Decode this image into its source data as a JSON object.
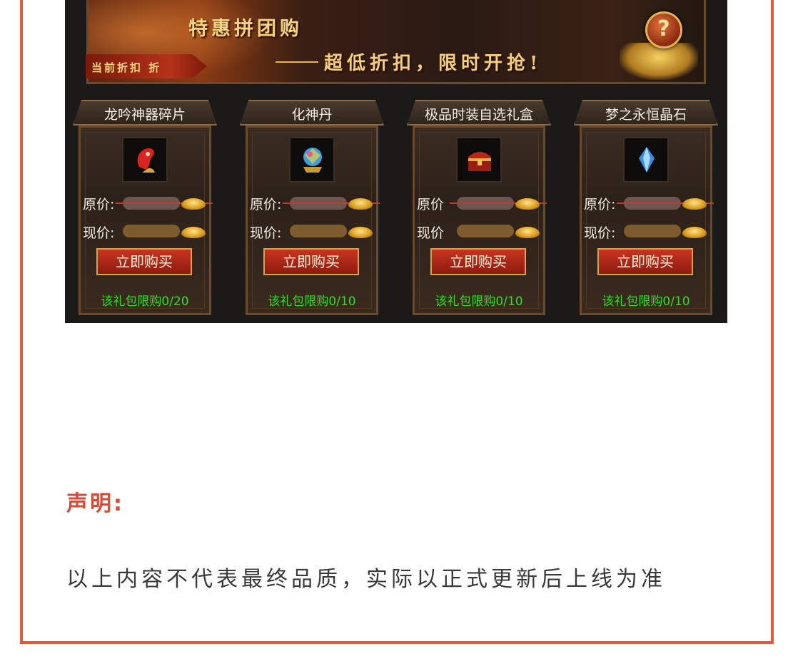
{
  "banner": {
    "title": "特惠拼团购",
    "subtitle": "超低折扣，限时开抢!",
    "discount_label": "当前折扣    折",
    "help_label": "?"
  },
  "cards": [
    {
      "name": "龙吟神器碎片",
      "orig_label": "原价:",
      "now_label": "现价:",
      "buy": "立即购买",
      "limit": "该礼包限购0/20",
      "icon": "red-dragon-shard-icon"
    },
    {
      "name": "化神丹",
      "orig_label": "原价:",
      "now_label": "现价:",
      "buy": "立即购买",
      "limit": "该礼包限购0/10",
      "icon": "crystal-orb-icon"
    },
    {
      "name": "极品时装自选礼盒",
      "orig_label": "原价",
      "now_label": "现价",
      "buy": "立即购买",
      "limit": "该礼包限购0/10",
      "icon": "treasure-chest-icon"
    },
    {
      "name": "梦之永恒晶石",
      "orig_label": "原价:",
      "now_label": "现价:",
      "buy": "立即购买",
      "limit": "该礼包限购0/10",
      "icon": "blue-crystal-icon"
    }
  ],
  "declaration": {
    "title": "声明:",
    "text": "以上内容不代表最终品质，实际以正式更新后上线为准"
  },
  "colors": {
    "frame": "#e05b3a",
    "declaration_title": "#d64a36",
    "limit_text": "#2ee01e"
  }
}
